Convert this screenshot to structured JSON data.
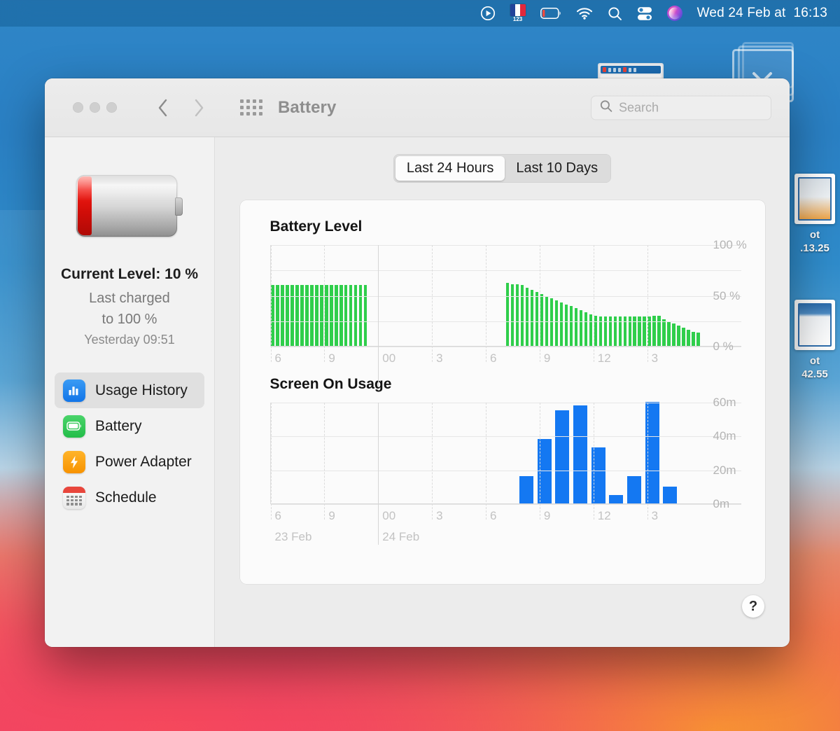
{
  "menubar": {
    "icons": [
      {
        "name": "control-center-play-icon",
        "glyph": "play-circle"
      },
      {
        "name": "input-source-flag-icon",
        "glyph": "french-flag",
        "badge": "123"
      },
      {
        "name": "battery-status-icon",
        "glyph": "battery-low"
      },
      {
        "name": "wifi-icon",
        "glyph": "wifi"
      },
      {
        "name": "spotlight-search-icon",
        "glyph": "magnifier"
      },
      {
        "name": "control-center-icon",
        "glyph": "sliders"
      },
      {
        "name": "siri-icon",
        "glyph": "siri-orb"
      }
    ],
    "date": "Wed 24 Feb at",
    "time": "16:13"
  },
  "desktop": {
    "stack_icon_name": "downloads-stack-icon",
    "files": [
      {
        "name_line1": "ot",
        "name_line2": ".13.25"
      },
      {
        "name_line1": "ot",
        "name_line2": "42.55"
      }
    ]
  },
  "window": {
    "title": "Battery",
    "traffic_lights": [
      "close",
      "minimize",
      "zoom"
    ],
    "nav_back": "‹",
    "nav_forward": "›",
    "search": {
      "placeholder": "Search",
      "value": ""
    }
  },
  "sidebar": {
    "current_level": "Current Level: 10 %",
    "last_charged_line1": "Last charged",
    "last_charged_line2": "to 100 %",
    "last_charged_time": "Yesterday 09:51",
    "battery_fill_percent": 10,
    "items": [
      {
        "label": "Usage History",
        "icon": "bar-chart-icon",
        "active": true
      },
      {
        "label": "Battery",
        "icon": "battery-icon",
        "active": false
      },
      {
        "label": "Power Adapter",
        "icon": "bolt-icon",
        "active": false
      },
      {
        "label": "Schedule",
        "icon": "calendar-icon",
        "active": false
      }
    ]
  },
  "segmented": {
    "options": [
      "Last 24 Hours",
      "Last 10 Days"
    ],
    "selected": "Last 24 Hours"
  },
  "help_button": "?",
  "colors": {
    "battery_green": "#2fce4b",
    "usage_blue": "#1478f2",
    "accent_red": "#e8463c"
  },
  "chart_data": [
    {
      "type": "bar",
      "title": "Battery Level",
      "xlabel": "",
      "ylabel": "",
      "ylim": [
        0,
        100
      ],
      "ytick_labels": [
        "0 %",
        "50 %",
        "100 %"
      ],
      "ytick_values": [
        0,
        50,
        100
      ],
      "gridlines": [
        0,
        25,
        50,
        75,
        100
      ],
      "xtick_labels": [
        "6",
        "9",
        "00",
        "3",
        "6",
        "9",
        "12",
        "3"
      ],
      "xtick_positions": [
        0,
        12.5,
        25,
        37.5,
        50,
        62.5,
        75,
        87.5
      ],
      "grid": true,
      "legend": "none",
      "series": [
        {
          "name": "Battery Level",
          "unit": "%",
          "values": [
            60,
            60,
            60,
            60,
            60,
            60,
            60,
            60,
            60,
            60,
            60,
            60,
            60,
            60,
            60,
            60,
            60,
            60,
            60,
            60,
            null,
            null,
            null,
            null,
            null,
            null,
            null,
            null,
            null,
            null,
            null,
            null,
            null,
            null,
            null,
            null,
            null,
            null,
            null,
            null,
            null,
            null,
            null,
            null,
            null,
            null,
            null,
            null,
            62,
            61,
            61,
            60,
            57,
            55,
            53,
            51,
            49,
            47,
            45,
            43,
            41,
            39,
            37,
            35,
            33,
            31,
            30,
            29,
            29,
            29,
            29,
            29,
            29,
            29,
            29,
            29,
            29,
            29,
            30,
            30,
            26,
            24,
            22,
            20,
            18,
            16,
            14,
            13
          ]
        }
      ]
    },
    {
      "type": "bar",
      "title": "Screen On Usage",
      "xlabel": "",
      "ylabel": "",
      "ylim": [
        0,
        60
      ],
      "ytick_labels": [
        "0m",
        "20m",
        "40m",
        "60m"
      ],
      "ytick_values": [
        0,
        20,
        40,
        60
      ],
      "gridlines": [
        0,
        20,
        40,
        60
      ],
      "xtick_labels": [
        "6",
        "9",
        "00",
        "3",
        "6",
        "9",
        "12",
        "3"
      ],
      "xtick_positions": [
        0,
        12.5,
        25,
        37.5,
        50,
        62.5,
        75,
        87.5
      ],
      "date_labels": [
        {
          "text": "23 Feb",
          "position": 0
        },
        {
          "text": "24 Feb",
          "position": 25
        }
      ],
      "grid": true,
      "legend": "none",
      "series": [
        {
          "name": "Screen On Usage",
          "unit": "m",
          "categories": [
            "8",
            "9",
            "10",
            "11",
            "12",
            "13",
            "14",
            "15",
            "16"
          ],
          "values": [
            16,
            38,
            55,
            58,
            33,
            5,
            16,
            60,
            10
          ],
          "start_position_percent": 57.5
        }
      ]
    }
  ]
}
